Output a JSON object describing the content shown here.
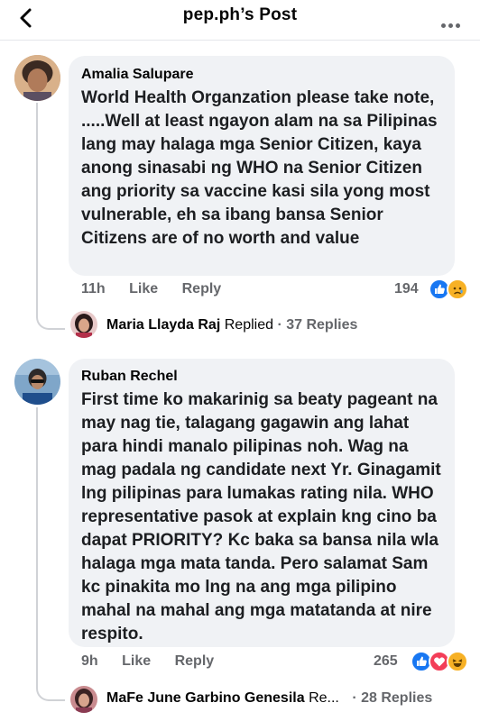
{
  "header": {
    "title": "pep.ph’s Post"
  },
  "comments": [
    {
      "author": "Amalia Salupare",
      "text": "World Health Organzation please take note, .....Well at least ngayon alam na sa Pilipinas lang may halaga mga Senior Citizen, kaya anong sinasabi ng WHO na Senior Citizen ang priority sa vaccine kasi sila yong most vulnerable, eh sa ibang bansa Senior Citizens are of no worth and value",
      "time": "11h",
      "like_label": "Like",
      "reply_label": "Reply",
      "reaction_count": "194",
      "reactions": [
        "like",
        "sad"
      ],
      "reply_preview": {
        "name": "Maria Llayda Raj",
        "status": "Replied",
        "count": "· 37 Replies"
      }
    },
    {
      "author": "Ruban Rechel",
      "text": "First time ko makarinig sa beaty pageant na may nag tie, talagang gagawin ang lahat para hindi manalo pilipinas noh. Wag na mag padala ng candidate next Yr. Ginagamit lng pilipinas para lumakas rating nila. WHO representative pasok at explain kng cino ba dapat PRIORITY? Kc baka sa bansa nila wla halaga mga mata tanda. Pero salamat Sam kc pinakita mo lng na ang mga pilipino mahal na mahal ang mga matatanda at nire respito.",
      "time": "9h",
      "like_label": "Like",
      "reply_label": "Reply",
      "reaction_count": "265",
      "reactions": [
        "like",
        "love",
        "haha"
      ],
      "reply_preview": {
        "name": "MaFe June Garbino Genesila",
        "status": "Re...",
        "count": "· 28 Replies"
      }
    }
  ],
  "colors": {
    "like": "#1877f2",
    "love": "#f33e58",
    "reaction_yellow": "#f7b125",
    "bubble": "#f0f2f5",
    "meta": "#65676b"
  }
}
